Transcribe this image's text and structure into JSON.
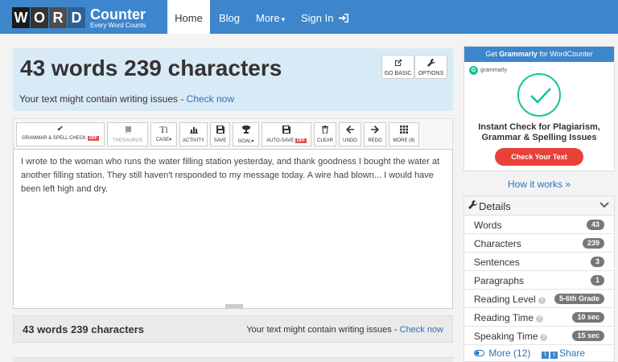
{
  "brand": {
    "letters": [
      "W",
      "O",
      "R",
      "D"
    ],
    "counter": "Counter",
    "tagline": "Every Word Counts",
    "colors": [
      "#1a1a1a",
      "#333333",
      "#4d4d4d",
      "#2f5f94"
    ]
  },
  "nav": {
    "items": [
      {
        "label": "Home",
        "active": true
      },
      {
        "label": "Blog"
      },
      {
        "label": "More",
        "caret": "▾"
      },
      {
        "label": "Sign In",
        "icon": "sign-in-icon"
      }
    ]
  },
  "hero": {
    "title": "43 words 239 characters",
    "issue_text": "Your text might contain writing issues - ",
    "issue_link": "Check now",
    "buttons": [
      {
        "label": "GO BASIC",
        "icon": "external-link-icon"
      },
      {
        "label": "OPTIONS",
        "icon": "wrench-icon"
      }
    ]
  },
  "toolbar": {
    "buttons": [
      {
        "label": "GRAMMAR & SPELL CHECK",
        "badge": "OFF",
        "icon": "check-icon"
      },
      {
        "label": "THESAURUS",
        "icon": "book-icon",
        "disabled": true
      },
      {
        "label": "CASE",
        "caret": "▾",
        "icon": "text-size-icon"
      },
      {
        "label": "ACTIVITY",
        "icon": "bar-chart-icon"
      },
      {
        "label": "SAVE",
        "icon": "save-icon"
      },
      {
        "label": "GOAL",
        "caret": "▾",
        "icon": "trophy-icon"
      },
      {
        "label": "AUTO-SAVE",
        "badge": "OFF",
        "icon": "save-icon"
      },
      {
        "label": "CLEAR",
        "icon": "trash-icon"
      },
      {
        "label": "UNDO",
        "icon": "arrow-left-icon"
      },
      {
        "label": "REDO",
        "icon": "arrow-right-icon"
      },
      {
        "label": "MORE (9)",
        "icon": "grid-icon"
      }
    ]
  },
  "editor": {
    "text": "I wrote to the woman who runs the water filling station yesterday, and thank goodness I bought the water at another filling station. They still haven't responded to my message today. A wire had blown... I would have been left high and dry."
  },
  "footer_bar": {
    "count": "43 words 239 characters",
    "issue_text": "Your text might contain writing issues - ",
    "issue_link": "Check now"
  },
  "ad": {
    "header_prefix": "Get ",
    "header_brand": "Grammarly",
    "header_suffix": " for WordCounter",
    "brand": "grammarly",
    "line1": "Instant Check for Plagiarism,",
    "line2": "Grammar & Spelling Issues",
    "cta": "Check Your Text",
    "accent": "#15c39a",
    "cta_color": "#e8413a"
  },
  "how_it_works": "How it works »",
  "details": {
    "title": "Details",
    "rows": [
      {
        "label": "Words",
        "value": "43"
      },
      {
        "label": "Characters",
        "value": "239"
      },
      {
        "label": "Sentences",
        "value": "3"
      },
      {
        "label": "Paragraphs",
        "value": "1"
      },
      {
        "label": "Reading Level",
        "value": "5-6th Grade",
        "help": true
      },
      {
        "label": "Reading Time",
        "value": "10 sec",
        "help": true
      },
      {
        "label": "Speaking Time",
        "value": "15 sec",
        "help": true
      }
    ],
    "more": "More (12)",
    "share": "Share"
  }
}
